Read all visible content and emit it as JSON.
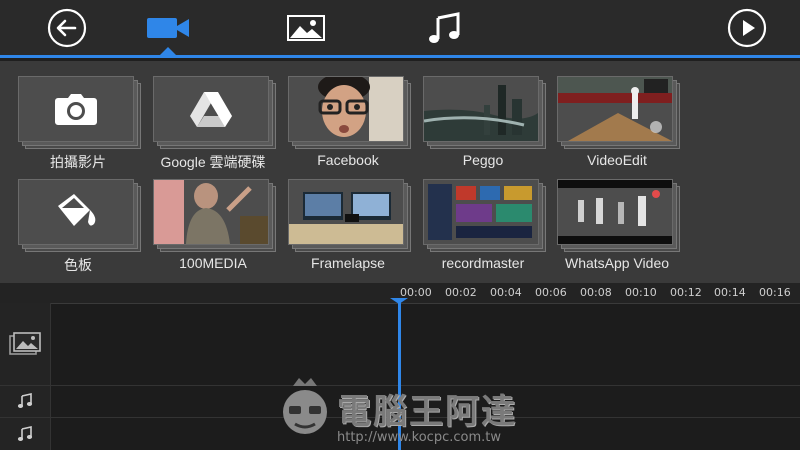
{
  "toolbar": {
    "back_icon": "back-arrow-icon",
    "tabs": [
      {
        "icon": "video-camera-icon",
        "active": true
      },
      {
        "icon": "image-icon",
        "active": false
      },
      {
        "icon": "music-note-icon",
        "active": false
      }
    ],
    "play_icon": "play-icon",
    "accent_color": "#2f86e8"
  },
  "gallery": {
    "items": [
      {
        "label": "拍攝影片",
        "icon": "camera-icon"
      },
      {
        "label": "Google 雲端硬碟",
        "icon": "google-drive-icon"
      },
      {
        "label": "Facebook"
      },
      {
        "label": "Peggo"
      },
      {
        "label": "VideoEdit"
      },
      {
        "label": "色板",
        "icon": "paint-bucket-icon"
      },
      {
        "label": "100MEDIA"
      },
      {
        "label": "Framelapse"
      },
      {
        "label": "recordmaster"
      },
      {
        "label": "WhatsApp Video"
      }
    ]
  },
  "timeline": {
    "ticks": [
      "00:00",
      "00:02",
      "00:04",
      "00:06",
      "00:08",
      "00:10",
      "00:12",
      "00:14",
      "00:16"
    ],
    "tracks": [
      {
        "icon": "video-track-icon"
      },
      {
        "icon": "audio-track-icon"
      },
      {
        "icon": "audio-track-icon"
      }
    ]
  },
  "watermark": {
    "text": "電腦王阿達",
    "url": "http://www.kocpc.com.tw"
  }
}
